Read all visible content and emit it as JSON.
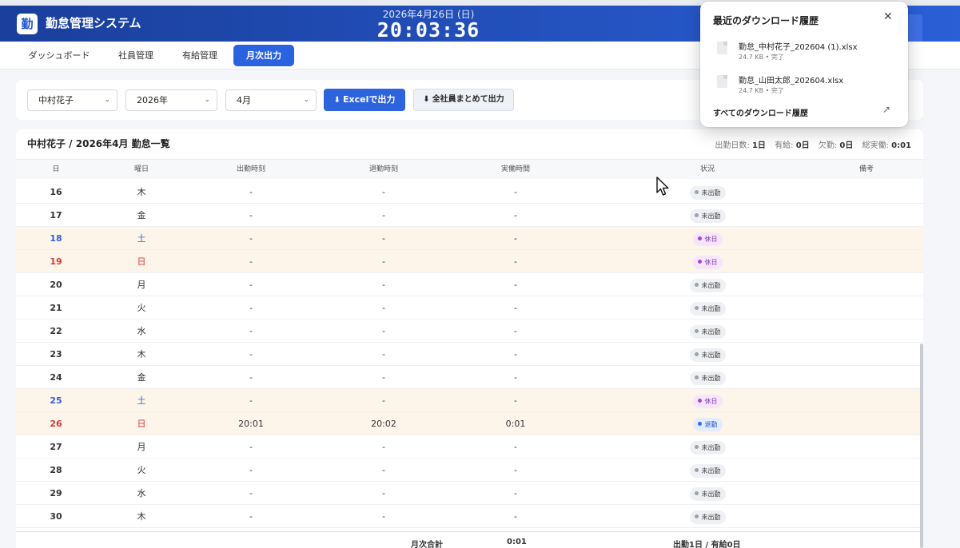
{
  "header": {
    "logo_char": "勤",
    "title": "勤怠管理システム",
    "date": "2026年4月26日 (日)",
    "time": "20:03:36"
  },
  "nav": {
    "tabs": [
      {
        "label": "ダッシュボード",
        "active": false
      },
      {
        "label": "社員管理",
        "active": false
      },
      {
        "label": "有給管理",
        "active": false
      },
      {
        "label": "月次出力",
        "active": true
      }
    ]
  },
  "filters": {
    "employee": "中村花子",
    "year": "2026年",
    "month": "4月",
    "excel_button": "Excelで出力",
    "all_button": "全社員まとめて出力"
  },
  "table": {
    "title": "中村花子 / 2026年4月 勤怠一覧",
    "stats": {
      "attend_label": "出勤日数:",
      "attend_value": "1日",
      "paid_label": "有給:",
      "paid_value": "0日",
      "absent_label": "欠勤:",
      "absent_value": "0日",
      "total_label": "総実働:",
      "total_value": "0:01"
    },
    "columns": [
      "日",
      "曜日",
      "出勤時刻",
      "退勤時刻",
      "実働時間",
      "状況",
      "備考"
    ],
    "rows": [
      {
        "day": "16",
        "weekday": "木",
        "in": "-",
        "out": "-",
        "work": "-",
        "status": "未出勤",
        "type": "normal"
      },
      {
        "day": "17",
        "weekday": "金",
        "in": "-",
        "out": "-",
        "work": "-",
        "status": "未出勤",
        "type": "normal"
      },
      {
        "day": "18",
        "weekday": "土",
        "in": "-",
        "out": "-",
        "work": "-",
        "status": "休日",
        "type": "sat"
      },
      {
        "day": "19",
        "weekday": "日",
        "in": "-",
        "out": "-",
        "work": "-",
        "status": "休日",
        "type": "sun"
      },
      {
        "day": "20",
        "weekday": "月",
        "in": "-",
        "out": "-",
        "work": "-",
        "status": "未出勤",
        "type": "normal"
      },
      {
        "day": "21",
        "weekday": "火",
        "in": "-",
        "out": "-",
        "work": "-",
        "status": "未出勤",
        "type": "normal"
      },
      {
        "day": "22",
        "weekday": "水",
        "in": "-",
        "out": "-",
        "work": "-",
        "status": "未出勤",
        "type": "normal"
      },
      {
        "day": "23",
        "weekday": "木",
        "in": "-",
        "out": "-",
        "work": "-",
        "status": "未出勤",
        "type": "normal"
      },
      {
        "day": "24",
        "weekday": "金",
        "in": "-",
        "out": "-",
        "work": "-",
        "status": "未出勤",
        "type": "normal"
      },
      {
        "day": "25",
        "weekday": "土",
        "in": "-",
        "out": "-",
        "work": "-",
        "status": "休日",
        "type": "sat"
      },
      {
        "day": "26",
        "weekday": "日",
        "in": "20:01",
        "out": "20:02",
        "work": "0:01",
        "status": "退勤",
        "type": "sun"
      },
      {
        "day": "27",
        "weekday": "月",
        "in": "-",
        "out": "-",
        "work": "-",
        "status": "未出勤",
        "type": "normal"
      },
      {
        "day": "28",
        "weekday": "火",
        "in": "-",
        "out": "-",
        "work": "-",
        "status": "未出勤",
        "type": "normal"
      },
      {
        "day": "29",
        "weekday": "水",
        "in": "-",
        "out": "-",
        "work": "-",
        "status": "未出勤",
        "type": "normal"
      },
      {
        "day": "30",
        "weekday": "木",
        "in": "-",
        "out": "-",
        "work": "-",
        "status": "未出勤",
        "type": "normal"
      }
    ],
    "footer": {
      "label": "月次合計",
      "total": "0:01",
      "summary": "出勤1日 / 有給0日"
    }
  },
  "downloads": {
    "title": "最近のダウンロード履歴",
    "items": [
      {
        "name": "勤怠_中村花子_202604 (1).xlsx",
        "meta": "24.7 KB • 完了"
      },
      {
        "name": "勤怠_山田太郎_202604.xlsx",
        "meta": "24.7 KB • 完了"
      }
    ],
    "all_link": "すべてのダウンロード履歴"
  }
}
